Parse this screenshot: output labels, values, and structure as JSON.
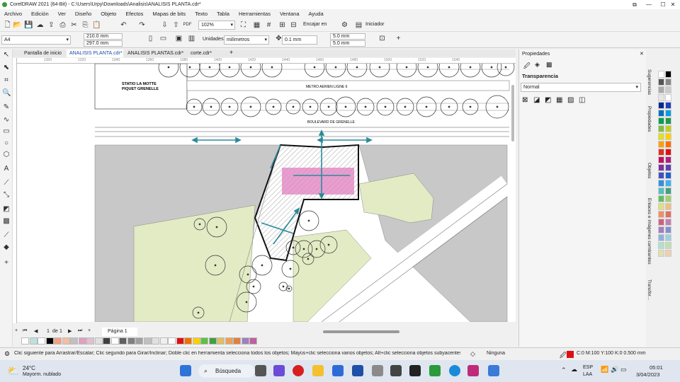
{
  "window": {
    "title": "CorelDRAW 2021 (64-Bit) - C:\\Users\\Urpy\\Downloads\\Analisis\\ANALISIS PLANTA.cdr*"
  },
  "menu": [
    "Archivo",
    "Edición",
    "Ver",
    "Diseño",
    "Objeto",
    "Efectos",
    "Mapas de bits",
    "Texto",
    "Tabla",
    "Herramientas",
    "Ventana",
    "Ayuda"
  ],
  "toolbar": {
    "zoom": "102%",
    "snap_label": "Encajar en",
    "launch_label": "Iniciador",
    "page_size": "A4",
    "width": "210.0 mm",
    "height": "297.0 mm",
    "units_label": "Unidades:",
    "units_value": "milímetros",
    "nudge": "0.1 mm",
    "dup_x": "5.0 mm",
    "dup_y": "5.0 mm"
  },
  "tabs": [
    {
      "label": "Pantalla de inicio"
    },
    {
      "label": "ANALISIS PLANTA.cdr*"
    },
    {
      "label": "ANALISIS PLANTAS.cdr*"
    },
    {
      "label": "corte.cdr*"
    }
  ],
  "ruler_ticks": [
    "1300",
    "1320",
    "1340",
    "1360",
    "1380",
    "1400",
    "1420",
    "1440",
    "1460",
    "1480",
    "1500",
    "1520",
    "1540"
  ],
  "drawing": {
    "station_label_1": "STATIO LA MOTTE",
    "station_label_2": "PIQUET GRENELLE",
    "metro_label": "METRO AERIEN LIGNE 6",
    "boulevard_label": "BOULEVARD DE GRENELLE"
  },
  "properties": {
    "header": "Propiedades",
    "section": "Transparencia",
    "mode": "Normal"
  },
  "side_tabs": [
    "Sugerencias",
    "Propiedades",
    "Objetos",
    "Enlaces e imágenes cambiantes",
    "Transfor..."
  ],
  "pages": {
    "current": "1",
    "of_label": "de",
    "total": "1",
    "page_tab": "Página 1"
  },
  "status": {
    "hint": "Clic siguiente para Arrastrar/Escalar; Clic segundo para Girar/Inclinar; Doble clic en herramienta selecciona todos los objetos; Mayús+clic selecciona varios objetos; Alt+clic selecciona objetos subyacentes",
    "fill_label": "Ninguna",
    "outline_label": "C:0 M:100 Y:100 K:0  0.500 mm"
  },
  "taskbar": {
    "temp": "24°C",
    "weather": "Mayorm. nublado",
    "search": "Búsqueda",
    "lang1": "ESP",
    "lang2": "LAA",
    "time": "05:01",
    "date": "3/04/2023"
  },
  "colors": {
    "accent_teal": "#2a8b9b",
    "pink": "#e07fc0",
    "green_area": "#e2ebc4",
    "grey_block": "#c8c8c8",
    "outline_red": "#e01010"
  }
}
